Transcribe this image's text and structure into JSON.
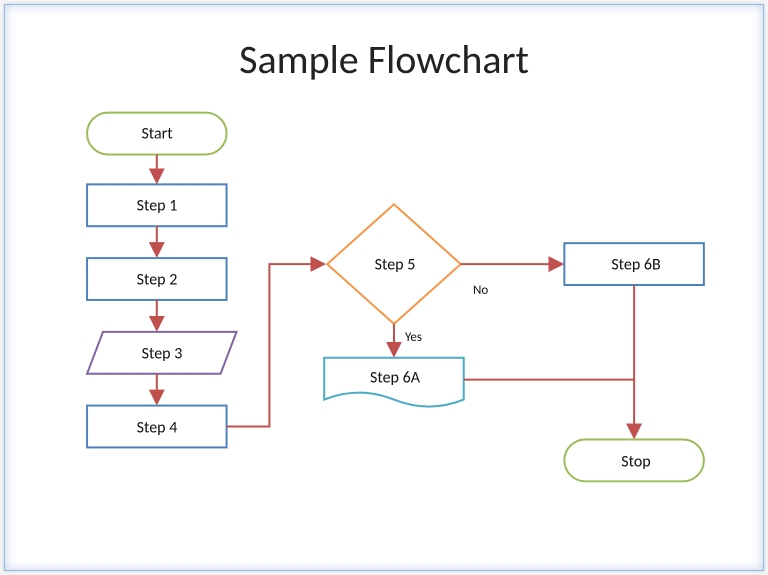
{
  "title": "Sample Flowchart",
  "nodes": {
    "start": {
      "label": "Start",
      "type": "terminator"
    },
    "step1": {
      "label": "Step 1",
      "type": "process"
    },
    "step2": {
      "label": "Step 2",
      "type": "process"
    },
    "step3": {
      "label": "Step 3",
      "type": "data"
    },
    "step4": {
      "label": "Step 4",
      "type": "process"
    },
    "step5": {
      "label": "Step 5",
      "type": "decision"
    },
    "step6a": {
      "label": "Step 6A",
      "type": "document"
    },
    "step6b": {
      "label": "Step 6B",
      "type": "process"
    },
    "stop": {
      "label": "Stop",
      "type": "terminator"
    }
  },
  "branches": {
    "no": "No",
    "yes": "Yes"
  },
  "edges": [
    {
      "from": "start",
      "to": "step1"
    },
    {
      "from": "step1",
      "to": "step2"
    },
    {
      "from": "step2",
      "to": "step3"
    },
    {
      "from": "step3",
      "to": "step4"
    },
    {
      "from": "step4",
      "to": "step5"
    },
    {
      "from": "step5",
      "to": "step6a",
      "label": "yes"
    },
    {
      "from": "step5",
      "to": "step6b",
      "label": "no"
    },
    {
      "from": "step6a",
      "to": "stop"
    },
    {
      "from": "step6b",
      "to": "stop"
    }
  ],
  "colors": {
    "terminator_stroke": "#9bbb59",
    "process_stroke": "#4f81bd",
    "data_stroke": "#8064a2",
    "decision_stroke": "#f79646",
    "document_stroke": "#4bacc6",
    "arrow": "#c0504d"
  }
}
